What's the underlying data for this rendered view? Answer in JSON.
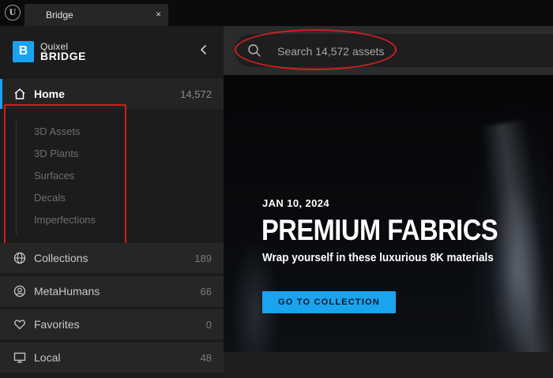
{
  "window": {
    "app_icon": "unreal-engine-logo-icon",
    "tab_label": "Bridge",
    "tab_close": "×"
  },
  "sidebar": {
    "brand": {
      "mark": "B",
      "line1": "Quixel",
      "line2": "BRIDGE"
    },
    "collapse_icon": "chevron-left-icon",
    "home": {
      "label": "Home",
      "count": "14,572",
      "icon": "home-icon"
    },
    "subitems": [
      "3D Assets",
      "3D Plants",
      "Surfaces",
      "Decals",
      "Imperfections"
    ],
    "items": [
      {
        "label": "Collections",
        "count": "189",
        "icon": "globe-icon"
      },
      {
        "label": "MetaHumans",
        "count": "66",
        "icon": "person-circle-icon"
      },
      {
        "label": "Favorites",
        "count": "0",
        "icon": "heart-icon"
      },
      {
        "label": "Local",
        "count": "48",
        "icon": "monitor-icon"
      }
    ]
  },
  "search": {
    "placeholder": "Search 14,572 assets",
    "value": "",
    "icon": "search-icon"
  },
  "hero": {
    "date": "JAN 10, 2024",
    "title": "PREMIUM FABRICS",
    "subtitle": "Wrap yourself in these luxurious 8K materials",
    "cta_label": "GO TO COLLECTION"
  },
  "colors": {
    "accent": "#19a2ef",
    "annotation": "#cc2020",
    "sidebar_bg": "#1c1c1c"
  }
}
